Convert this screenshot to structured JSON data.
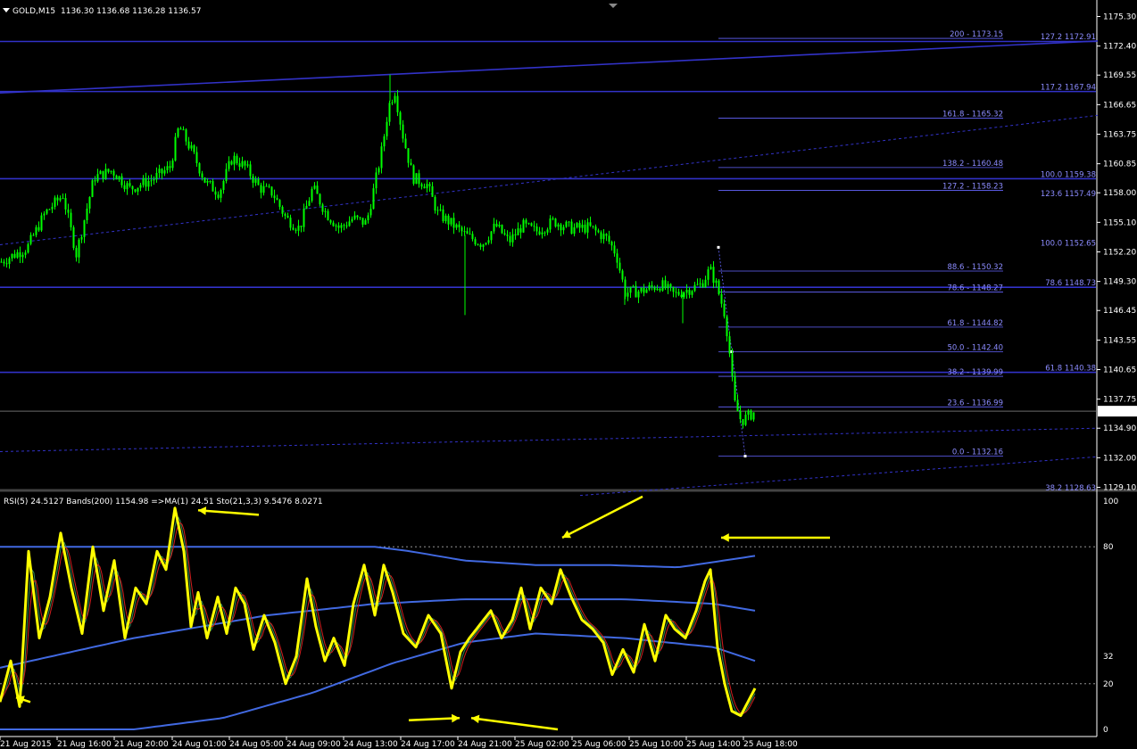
{
  "header": {
    "symbol": "GOLD,M15",
    "ohlc": "1136.30 1136.68 1136.28 1136.57"
  },
  "indicator_header": "RSI(5) 24.5127 Bands(200) 1154.98 =>MA(1) 24.51 Sto(21,3,3) 9.5476 8.0271",
  "colors": {
    "background": "#000000",
    "candle": "#00ff00",
    "grid_line": "#3232c8",
    "fib_line": "#6464ff",
    "fib_text": "#8c8cff",
    "rsi": "#ffff00",
    "bands": "#4169e1",
    "sto_main": "#2e8b57",
    "sto_signal": "#d21e1e",
    "arrow": "#ffff00",
    "axis_text": "#ffffff"
  },
  "price_axis": [
    "1175.30",
    "1172.40",
    "1169.55",
    "1166.65",
    "1163.75",
    "1160.85",
    "1158.00",
    "1155.10",
    "1152.20",
    "1149.30",
    "1146.45",
    "1143.55",
    "1140.65",
    "1137.75",
    "1134.90",
    "1132.00",
    "1129.10"
  ],
  "current_price": "1136.57",
  "osc_axis": [
    "100",
    "80",
    "32",
    "20",
    "0"
  ],
  "time_axis": [
    "21 Aug 2015",
    "21 Aug 16:00",
    "21 Aug 20:00",
    "24 Aug 01:00",
    "24 Aug 05:00",
    "24 Aug 09:00",
    "24 Aug 13:00",
    "24 Aug 17:00",
    "24 Aug 21:00",
    "25 Aug 02:00",
    "25 Aug 06:00",
    "25 Aug 10:00",
    "25 Aug 14:00",
    "25 Aug 18:00"
  ],
  "fib_levels_right": [
    {
      "label": "200 - 1173.15",
      "price": 1173.15
    },
    {
      "label": "127.2 1172.91",
      "price": 1172.91
    },
    {
      "label": "117.2 1167.94",
      "price": 1167.94
    },
    {
      "label": "161.8 - 1165.32",
      "price": 1165.32
    },
    {
      "label": "138.2 - 1160.48",
      "price": 1160.48
    },
    {
      "label": "100.0 1159.38",
      "price": 1159.38
    },
    {
      "label": "127.2 - 1158.23",
      "price": 1158.23
    },
    {
      "label": "123.6 1157.49",
      "price": 1157.49
    },
    {
      "label": "100.0 1152.65",
      "price": 1152.65
    },
    {
      "label": "88.6 - 1150.32",
      "price": 1150.32
    },
    {
      "label": "78.6 1148.73",
      "price": 1148.73
    },
    {
      "label": "78.6 - 1148.27",
      "price": 1148.27
    },
    {
      "label": "61.8 - 1144.82",
      "price": 1144.82
    },
    {
      "label": "50.0 - 1142.40",
      "price": 1142.4
    },
    {
      "label": "61.8 1140.38",
      "price": 1140.38
    },
    {
      "label": "38.2 - 1139.99",
      "price": 1139.99
    },
    {
      "label": "23.6 - 1136.99",
      "price": 1136.99
    },
    {
      "label": "0.0 - 1132.16",
      "price": 1132.16
    },
    {
      "label": "38.2 1128.63",
      "price": 1128.63
    }
  ],
  "chart_data": {
    "type": "candlestick",
    "symbol": "GOLD",
    "timeframe": "M15",
    "ylim": [
      1128.0,
      1176.5
    ],
    "key_prices": {
      "open_start": 1151.0,
      "high": 1169.6,
      "low_late": 1134.6,
      "last": 1136.57
    },
    "price_path": [
      [
        0,
        1151.2
      ],
      [
        30,
        1152.6
      ],
      [
        50,
        1156.0
      ],
      [
        70,
        1157.8
      ],
      [
        85,
        1152.0
      ],
      [
        105,
        1159.5
      ],
      [
        125,
        1160.2
      ],
      [
        145,
        1158.4
      ],
      [
        170,
        1159.3
      ],
      [
        190,
        1160.5
      ],
      [
        200,
        1164.5
      ],
      [
        215,
        1162.0
      ],
      [
        230,
        1159.0
      ],
      [
        245,
        1158.0
      ],
      [
        260,
        1161.5
      ],
      [
        275,
        1160.5
      ],
      [
        290,
        1158.5
      ],
      [
        305,
        1158.0
      ],
      [
        320,
        1155.5
      ],
      [
        335,
        1154.5
      ],
      [
        350,
        1158.5
      ],
      [
        365,
        1156.0
      ],
      [
        380,
        1154.5
      ],
      [
        395,
        1155.5
      ],
      [
        410,
        1155.0
      ],
      [
        420,
        1159.0
      ],
      [
        428,
        1162.5
      ],
      [
        435,
        1166.5
      ],
      [
        442,
        1168.0
      ],
      [
        450,
        1164.0
      ],
      [
        462,
        1159.5
      ],
      [
        478,
        1158.8
      ],
      [
        490,
        1156.0
      ],
      [
        505,
        1155.0
      ],
      [
        522,
        1153.8
      ],
      [
        540,
        1153.0
      ],
      [
        555,
        1154.8
      ],
      [
        570,
        1153.2
      ],
      [
        585,
        1154.8
      ],
      [
        600,
        1154.2
      ],
      [
        620,
        1155.2
      ],
      [
        640,
        1154.5
      ],
      [
        660,
        1154.6
      ],
      [
        680,
        1153.5
      ],
      [
        690,
        1152.0
      ],
      [
        700,
        1148.2
      ],
      [
        720,
        1148.4
      ],
      [
        740,
        1149.0
      ],
      [
        755,
        1148.0
      ],
      [
        770,
        1148.5
      ],
      [
        785,
        1149.0
      ],
      [
        795,
        1150.5
      ],
      [
        802,
        1149.0
      ],
      [
        812,
        1146.0
      ],
      [
        818,
        1141.5
      ],
      [
        822,
        1137.5
      ],
      [
        830,
        1135.6
      ],
      [
        840,
        1136.2
      ],
      [
        846,
        1136.57
      ]
    ],
    "spikes": [
      [
        437,
        1169.6
      ],
      [
        521,
        1146.0
      ],
      [
        700,
        1147.0
      ],
      [
        765,
        1145.2
      ]
    ],
    "horizontal_lines": [
      1172.85,
      1167.94,
      1159.38,
      1148.73,
      1140.38,
      1136.57
    ],
    "trendlines": [
      {
        "from": [
          0,
          1167.8
        ],
        "to": [
          1230,
          1172.9
        ],
        "style": "solid"
      },
      {
        "from": [
          0,
          1152.9
        ],
        "to": [
          1230,
          1165.6
        ],
        "style": "dashed"
      },
      {
        "from": [
          0,
          1132.6
        ],
        "to": [
          1230,
          1134.9
        ],
        "style": "dashed"
      },
      {
        "from": [
          650,
          1128.3
        ],
        "to": [
          1230,
          1132.1
        ],
        "style": "dashed"
      }
    ],
    "fib_retracement": {
      "from": [
        805,
        1152.65
      ],
      "to": [
        835,
        1132.16
      ],
      "levels": [
        100.0,
        88.6,
        78.6,
        61.8,
        50.0,
        38.2,
        23.6,
        0.0
      ]
    },
    "indicators": {
      "rsi_period": 5,
      "rsi_last": 24.5127,
      "bands_period": 200,
      "bands_value": 1154.98,
      "ma_period": 1,
      "ma_value": 24.51,
      "stochastic": {
        "params": "21,3,3",
        "main": 9.5476,
        "signal": 8.0271
      },
      "osc_range": [
        0,
        100
      ],
      "rsi_path": [
        [
          0,
          12
        ],
        [
          12,
          30
        ],
        [
          22,
          10
        ],
        [
          32,
          78
        ],
        [
          44,
          40
        ],
        [
          56,
          58
        ],
        [
          68,
          86
        ],
        [
          80,
          62
        ],
        [
          92,
          42
        ],
        [
          104,
          80
        ],
        [
          116,
          52
        ],
        [
          128,
          74
        ],
        [
          140,
          40
        ],
        [
          152,
          62
        ],
        [
          164,
          55
        ],
        [
          176,
          78
        ],
        [
          186,
          70
        ],
        [
          196,
          97
        ],
        [
          206,
          78
        ],
        [
          214,
          45
        ],
        [
          222,
          60
        ],
        [
          232,
          40
        ],
        [
          244,
          58
        ],
        [
          254,
          42
        ],
        [
          264,
          62
        ],
        [
          274,
          55
        ],
        [
          284,
          35
        ],
        [
          296,
          50
        ],
        [
          308,
          38
        ],
        [
          320,
          20
        ],
        [
          332,
          32
        ],
        [
          344,
          66
        ],
        [
          354,
          45
        ],
        [
          364,
          30
        ],
        [
          374,
          40
        ],
        [
          386,
          28
        ],
        [
          396,
          55
        ],
        [
          408,
          72
        ],
        [
          420,
          50
        ],
        [
          430,
          72
        ],
        [
          440,
          60
        ],
        [
          452,
          42
        ],
        [
          466,
          36
        ],
        [
          480,
          50
        ],
        [
          494,
          42
        ],
        [
          506,
          18
        ],
        [
          516,
          34
        ],
        [
          526,
          40
        ],
        [
          536,
          45
        ],
        [
          550,
          52
        ],
        [
          562,
          40
        ],
        [
          574,
          48
        ],
        [
          584,
          62
        ],
        [
          594,
          44
        ],
        [
          606,
          62
        ],
        [
          618,
          55
        ],
        [
          628,
          70
        ],
        [
          640,
          58
        ],
        [
          652,
          48
        ],
        [
          664,
          44
        ],
        [
          676,
          38
        ],
        [
          686,
          24
        ],
        [
          698,
          35
        ],
        [
          710,
          25
        ],
        [
          722,
          46
        ],
        [
          734,
          30
        ],
        [
          746,
          50
        ],
        [
          756,
          44
        ],
        [
          768,
          40
        ],
        [
          780,
          52
        ],
        [
          790,
          65
        ],
        [
          796,
          70
        ],
        [
          804,
          36
        ],
        [
          812,
          20
        ],
        [
          820,
          8
        ],
        [
          830,
          6
        ],
        [
          838,
          12
        ],
        [
          846,
          18
        ]
      ],
      "band_upper": [
        [
          0,
          80
        ],
        [
          150,
          80
        ],
        [
          300,
          80
        ],
        [
          420,
          80
        ],
        [
          460,
          78
        ],
        [
          520,
          74
        ],
        [
          600,
          72
        ],
        [
          680,
          72
        ],
        [
          760,
          71
        ],
        [
          846,
          76
        ]
      ],
      "band_middle": [
        [
          0,
          27
        ],
        [
          150,
          40
        ],
        [
          300,
          50
        ],
        [
          420,
          55
        ],
        [
          520,
          57
        ],
        [
          600,
          57
        ],
        [
          700,
          57
        ],
        [
          800,
          55
        ],
        [
          846,
          52
        ]
      ],
      "band_lower": [
        [
          0,
          0
        ],
        [
          150,
          0
        ],
        [
          250,
          5
        ],
        [
          350,
          16
        ],
        [
          440,
          29
        ],
        [
          520,
          38
        ],
        [
          600,
          42
        ],
        [
          700,
          40
        ],
        [
          800,
          36
        ],
        [
          846,
          30
        ]
      ],
      "arrows": [
        {
          "from": [
            290,
            94
          ],
          "to": [
            222,
            96
          ]
        },
        {
          "from": [
            720,
            102
          ],
          "to": [
            630,
            84
          ]
        },
        {
          "from": [
            930,
            84
          ],
          "to": [
            808,
            84
          ]
        },
        {
          "from": [
            458,
            4
          ],
          "to": [
            515,
            5
          ]
        },
        {
          "from": [
            625,
            0
          ],
          "to": [
            528,
            5
          ]
        },
        {
          "from": [
            34,
            12
          ],
          "to": [
            18,
            14
          ]
        }
      ]
    }
  }
}
